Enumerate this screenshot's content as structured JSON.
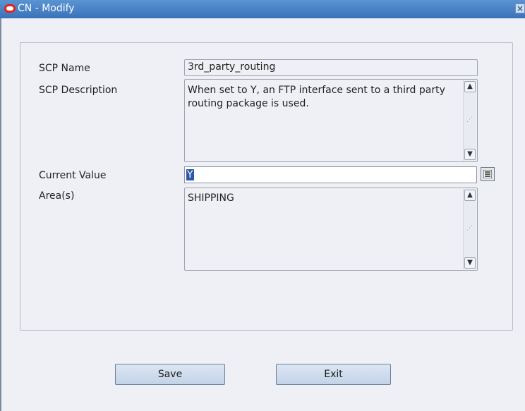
{
  "window": {
    "title": "CN - Modify"
  },
  "form": {
    "scp_name_label": "SCP Name",
    "scp_name_value": "3rd_party_routing",
    "scp_description_label": "SCP Description",
    "scp_description_value": "When set to Y, an FTP interface sent to a third party routing package is used.",
    "current_value_label": "Current Value",
    "current_value_value": "Y",
    "areas_label": "Area(s)",
    "areas_value": "SHIPPING"
  },
  "buttons": {
    "save_label": "Save",
    "exit_label": "Exit"
  },
  "icons": {
    "app_logo": "oracle-logo-icon",
    "close": "close-icon",
    "lov": "list-of-values-icon"
  },
  "colors": {
    "titlebar": "#3a72b8",
    "selection": "#2a5aa8",
    "background": "#eef0f5"
  }
}
